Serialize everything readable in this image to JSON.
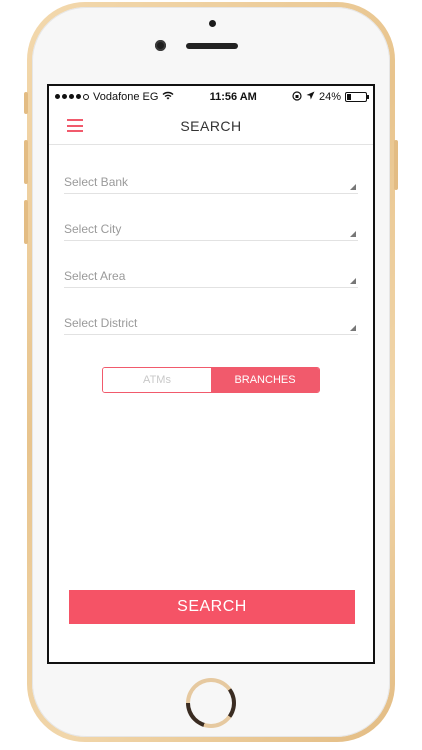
{
  "status_bar": {
    "carrier": "Vodafone EG",
    "time": "11:56 AM",
    "battery": "24%"
  },
  "header": {
    "title": "SEARCH"
  },
  "selects": [
    {
      "placeholder": "Select Bank"
    },
    {
      "placeholder": "Select City"
    },
    {
      "placeholder": "Select Area"
    },
    {
      "placeholder": "Select District"
    }
  ],
  "toggle": {
    "atm_label": "ATMs",
    "branches_label": "BRANCHES",
    "selected": "BRANCHES"
  },
  "actions": {
    "search_label": "SEARCH"
  },
  "colors": {
    "accent": "#f15a6c",
    "button": "#f55366"
  }
}
